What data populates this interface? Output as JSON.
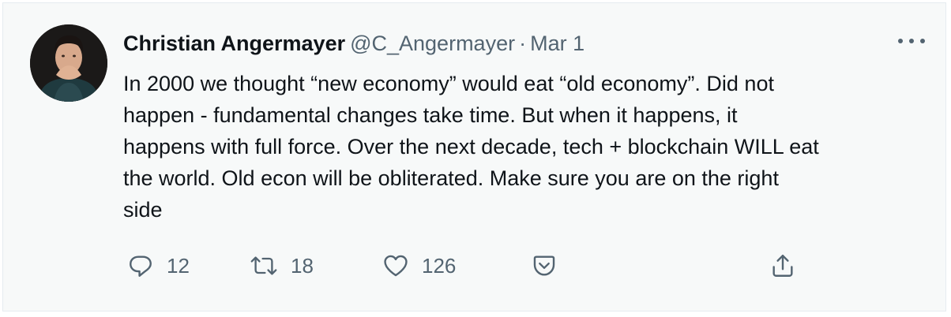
{
  "tweet": {
    "author_name": "Christian Angermayer",
    "handle": "@C_Angermayer",
    "separator": "·",
    "date": "Mar 1",
    "text": "In 2000 we thought “new economy” would eat “old economy”. Did not\nhappen - fundamental changes take time. But when it happens, it\nhappens with full force. Over the next decade, tech + blockchain WILL eat\nthe world. Old econ will be obliterated. Make sure you are on the right\nside"
  },
  "actions": {
    "replies": "12",
    "retweets": "18",
    "likes": "126"
  },
  "icons": {
    "reply": "reply-icon",
    "retweet": "retweet-icon",
    "like": "heart-icon",
    "save": "bookmark-icon",
    "share": "share-icon",
    "more": "more-icon"
  },
  "colors": {
    "background": "#f7f9f9",
    "text": "#0f1419",
    "secondary": "#536471"
  }
}
